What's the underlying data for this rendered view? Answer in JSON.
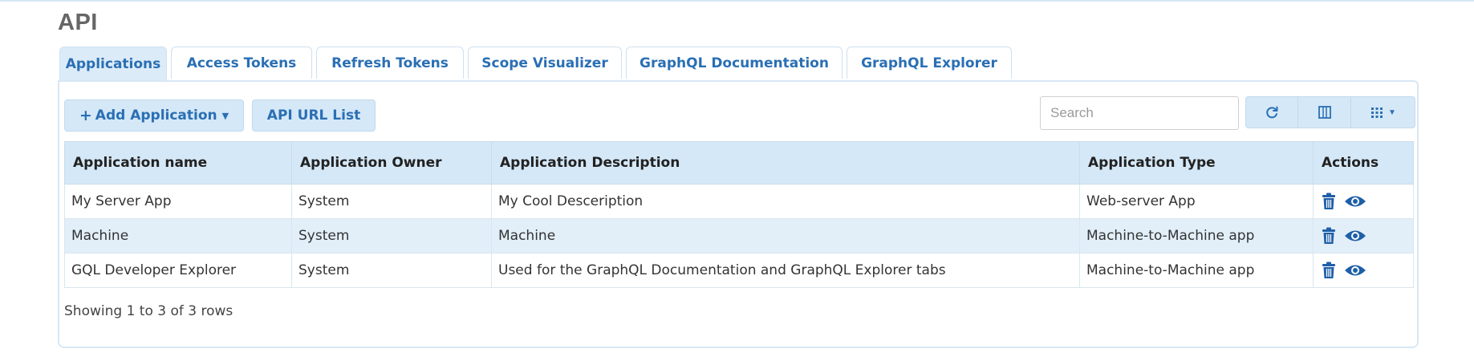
{
  "page": {
    "title": "API"
  },
  "tabs": [
    {
      "label": "Applications",
      "active": true
    },
    {
      "label": "Access Tokens",
      "active": false
    },
    {
      "label": "Refresh Tokens",
      "active": false
    },
    {
      "label": "Scope Visualizer",
      "active": false
    },
    {
      "label": "GraphQL Documentation",
      "active": false
    },
    {
      "label": "GraphQL Explorer",
      "active": false
    }
  ],
  "toolbar": {
    "add_application_label": "Add Application",
    "api_url_list_label": "API URL List",
    "search_placeholder": "Search",
    "search_value": "",
    "refresh_icon": "refresh-icon",
    "columns_icon": "columns-icon",
    "grid_icon": "grid-icon"
  },
  "table": {
    "columns": [
      "Application name",
      "Application Owner",
      "Application Description",
      "Application Type",
      "Actions"
    ],
    "rows": [
      {
        "name": "My Server App",
        "owner": "System",
        "description": "My Cool Desceription",
        "type": "Web-server App"
      },
      {
        "name": "Machine",
        "owner": "System",
        "description": "Machine",
        "type": "Machine-to-Machine app"
      },
      {
        "name": "GQL Developer Explorer",
        "owner": "System",
        "description": "Used for the GraphQL Documentation and GraphQL Explorer tabs",
        "type": "Machine-to-Machine app"
      }
    ],
    "row_actions": [
      "trash-icon",
      "eye-icon"
    ]
  },
  "footer": {
    "pagination_text": "Showing 1 to 3 of 3 rows"
  },
  "colors": {
    "accent": "#2a6fb4",
    "header_bg": "#d5e8f7",
    "alt_row_bg": "#e2eff9"
  }
}
